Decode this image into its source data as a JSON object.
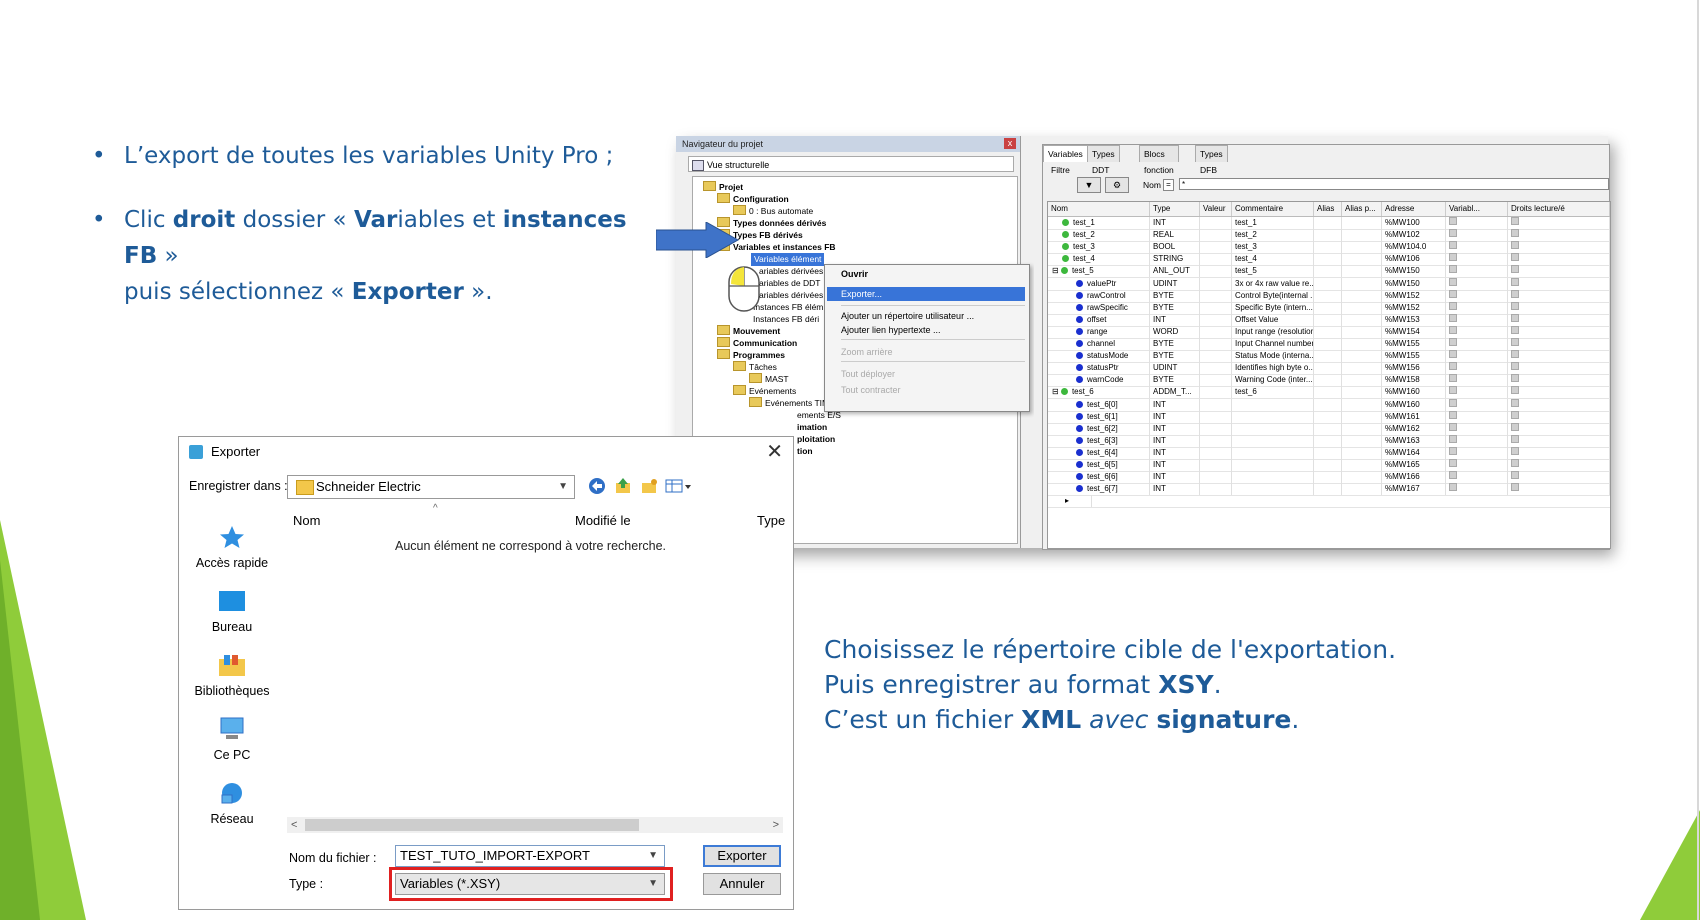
{
  "colors": {
    "text_blue": "#1e5b98",
    "slide_green": "#8fcc3a",
    "highlight": "#3874d8",
    "red_frame": "#e02020"
  },
  "bullets": [
    {
      "text_before": "L’export de toutes les variables Unity Pro ;"
    },
    {
      "p1": "Clic ",
      "b1": "droit",
      "p2": " dossier « ",
      "b2": "Var",
      "p3": "iables et ",
      "b3": "instances FB",
      "p4": " »",
      "line2_p1": "puis sélectionnez « ",
      "line2_b": "Exporter",
      "line2_p2": " »."
    }
  ],
  "caption": {
    "line1": "Choisissez le répertoire cible de l'exportation.",
    "line2_a": "Puis enregistrer au format ",
    "line2_b": "XSY",
    "line2_c": ".",
    "line3_a": "C’est un fichier ",
    "line3_b": "XML",
    "line3_c": "avec",
    "line3_d": "signature",
    "line3_e": "."
  },
  "navigator": {
    "title": "Navigateur du projet",
    "close": "x",
    "view": "Vue structurelle",
    "tree": [
      "Projet",
      "Configuration",
      "0 : Bus automate",
      "Types données dérivés",
      "Types FB dérivés",
      "Variables et instances FB",
      "Variables élément",
      "ariables dérivées",
      "ariables de DDT",
      "ariables dérivées",
      "Instances FB élém",
      "Instances FB déri",
      "Mouvement",
      "Communication",
      "Programmes",
      "Tâches",
      "MAST",
      "Evénements",
      "Evénements TIMER",
      "ements E/S",
      "imation",
      "ploitation",
      "tion"
    ]
  },
  "context_menu": {
    "items": [
      "Ouvrir",
      "Exporter...",
      "Ajouter un répertoire utilisateur ...",
      "Ajouter lien hypertexte ...",
      "Zoom arrière",
      "Tout déployer",
      "Tout contracter"
    ]
  },
  "vars_editor": {
    "tabs": [
      "Variables",
      "Types DDT",
      "Blocs fonction",
      "Types DFB"
    ],
    "filter_label": "Filtre",
    "nom_label": "Nom",
    "nom_eq": "=",
    "nom_value": "*",
    "columns": [
      "Nom",
      "Type",
      "Valeur",
      "Commentaire",
      "Alias",
      "Alias p...",
      "Adresse",
      "Variabl...",
      "Droits lecture/é"
    ],
    "rows": [
      {
        "name": "test_1",
        "type": "INT",
        "comment": "test_1",
        "addr": "%MW100",
        "kind": "g",
        "indent": 1
      },
      {
        "name": "test_2",
        "type": "REAL",
        "comment": "test_2",
        "addr": "%MW102",
        "kind": "g",
        "indent": 1
      },
      {
        "name": "test_3",
        "type": "BOOL",
        "comment": "test_3",
        "addr": "%MW104.0",
        "kind": "g",
        "indent": 1
      },
      {
        "name": "test_4",
        "type": "STRING",
        "comment": "test_4",
        "addr": "%MW106",
        "kind": "g",
        "indent": 1
      },
      {
        "name": "test_5",
        "type": "ANL_OUT",
        "comment": "test_5",
        "addr": "%MW150",
        "kind": "g",
        "indent": 0
      },
      {
        "name": "valuePtr",
        "type": "UDINT",
        "comment": "3x or 4x raw value re...",
        "addr": "%MW150",
        "kind": "b",
        "indent": 2
      },
      {
        "name": "rawControl",
        "type": "BYTE",
        "comment": "Control Byte(internal ...",
        "addr": "%MW152",
        "kind": "b",
        "indent": 2
      },
      {
        "name": "rawSpecific",
        "type": "BYTE",
        "comment": "Specific Byte (intern...",
        "addr": "%MW152",
        "kind": "b",
        "indent": 2
      },
      {
        "name": "offset",
        "type": "INT",
        "comment": "Offset Value",
        "addr": "%MW153",
        "kind": "b",
        "indent": 2
      },
      {
        "name": "range",
        "type": "WORD",
        "comment": "Input range (resolution)",
        "addr": "%MW154",
        "kind": "b",
        "indent": 2
      },
      {
        "name": "channel",
        "type": "BYTE",
        "comment": "Input Channel number",
        "addr": "%MW155",
        "kind": "b",
        "indent": 2
      },
      {
        "name": "statusMode",
        "type": "BYTE",
        "comment": "Status Mode (interna...",
        "addr": "%MW155",
        "kind": "b",
        "indent": 2
      },
      {
        "name": "statusPtr",
        "type": "UDINT",
        "comment": "Identifies high byte o...",
        "addr": "%MW156",
        "kind": "b",
        "indent": 2
      },
      {
        "name": "warnCode",
        "type": "BYTE",
        "comment": "Warning Code (inter...",
        "addr": "%MW158",
        "kind": "b",
        "indent": 2
      },
      {
        "name": "test_6",
        "type": "ADDM_T...",
        "comment": "test_6",
        "addr": "%MW160",
        "kind": "g",
        "indent": 0
      },
      {
        "name": "test_6[0]",
        "type": "INT",
        "comment": "",
        "addr": "%MW160",
        "kind": "b",
        "indent": 2
      },
      {
        "name": "test_6[1]",
        "type": "INT",
        "comment": "",
        "addr": "%MW161",
        "kind": "b",
        "indent": 2
      },
      {
        "name": "test_6[2]",
        "type": "INT",
        "comment": "",
        "addr": "%MW162",
        "kind": "b",
        "indent": 2
      },
      {
        "name": "test_6[3]",
        "type": "INT",
        "comment": "",
        "addr": "%MW163",
        "kind": "b",
        "indent": 2
      },
      {
        "name": "test_6[4]",
        "type": "INT",
        "comment": "",
        "addr": "%MW164",
        "kind": "b",
        "indent": 2
      },
      {
        "name": "test_6[5]",
        "type": "INT",
        "comment": "",
        "addr": "%MW165",
        "kind": "b",
        "indent": 2
      },
      {
        "name": "test_6[6]",
        "type": "INT",
        "comment": "",
        "addr": "%MW166",
        "kind": "b",
        "indent": 2
      },
      {
        "name": "test_6[7]",
        "type": "INT",
        "comment": "",
        "addr": "%MW167",
        "kind": "b",
        "indent": 2
      }
    ],
    "new_row_marker": "▸"
  },
  "export_dialog": {
    "title": "Exporter",
    "close": "✕",
    "save_in_label": "Enregistrer dans :",
    "save_in_value": "Schneider Electric",
    "places": [
      "Accès rapide",
      "Bureau",
      "Bibliothèques",
      "Ce PC",
      "Réseau"
    ],
    "columns": [
      "Nom",
      "Modifié le",
      "Type"
    ],
    "empty_message": "Aucun élément ne correspond à votre recherche.",
    "filename_label": "Nom du fichier :",
    "filename_value": "TEST_TUTO_IMPORT-EXPORT",
    "type_label": "Type :",
    "type_value": "Variables (*.XSY)",
    "export_button": "Exporter",
    "cancel_button": "Annuler"
  }
}
